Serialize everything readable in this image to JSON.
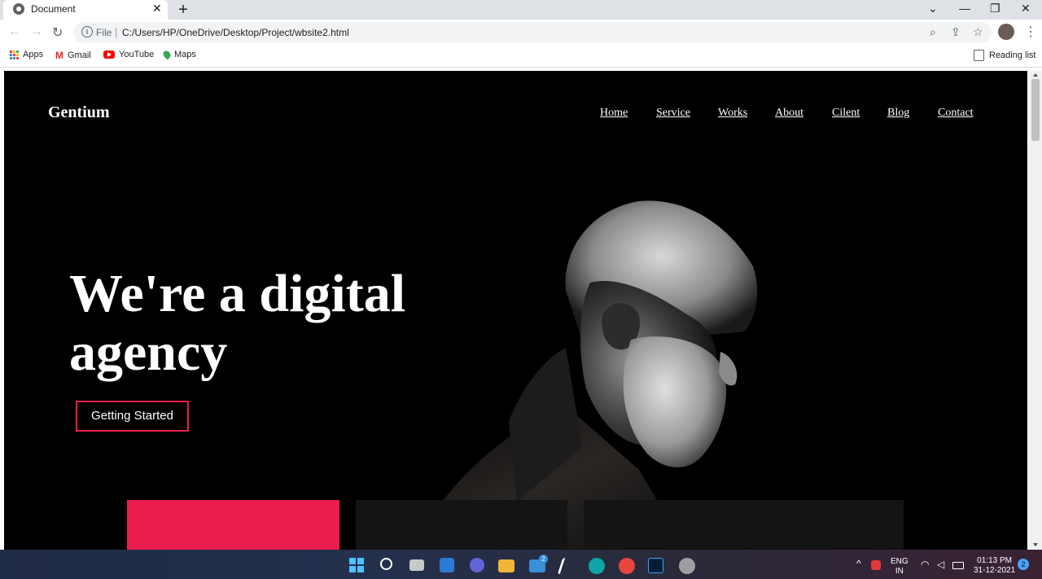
{
  "browser": {
    "tab": {
      "title": "Document",
      "close": "✕"
    },
    "new_tab": "+",
    "window_controls": {
      "dropdown": "⌄",
      "minimize": "—",
      "restore": "❐",
      "close": "✕"
    },
    "nav": {
      "back": "←",
      "forward": "→",
      "reload": "↻"
    },
    "omnibox": {
      "scheme": "File",
      "separator": "|",
      "url": "C:/Users/HP/OneDrive/Desktop/Project/wbsite2.html"
    },
    "omni_icons": {
      "zoom": "⌕",
      "share": "⇪",
      "star": "☆"
    },
    "menu": "⋮",
    "bookmarks": [
      {
        "label": "Apps",
        "icon": "apps-grid-icon"
      },
      {
        "label": "Gmail",
        "icon": "gmail-icon"
      },
      {
        "label": "YouTube",
        "icon": "youtube-icon"
      },
      {
        "label": "Maps",
        "icon": "maps-pin-icon"
      }
    ],
    "reading_list": "Reading list"
  },
  "page": {
    "brand": "Gentium",
    "nav": [
      "Home",
      "Service",
      "Works",
      "About",
      "Cilent",
      "Blog",
      "Contact"
    ],
    "headline": "We're a digital agency",
    "cta": "Getting Started",
    "colors": {
      "background": "#000000",
      "accent": "#e91e4c",
      "card_dark": "#141414"
    }
  },
  "taskbar": {
    "mail_badge": "2",
    "lang_top": "ENG",
    "lang_bottom": "IN",
    "time": "01:13 PM",
    "date": "31-12-2021",
    "notification_count": "2",
    "tray_up": "^"
  }
}
